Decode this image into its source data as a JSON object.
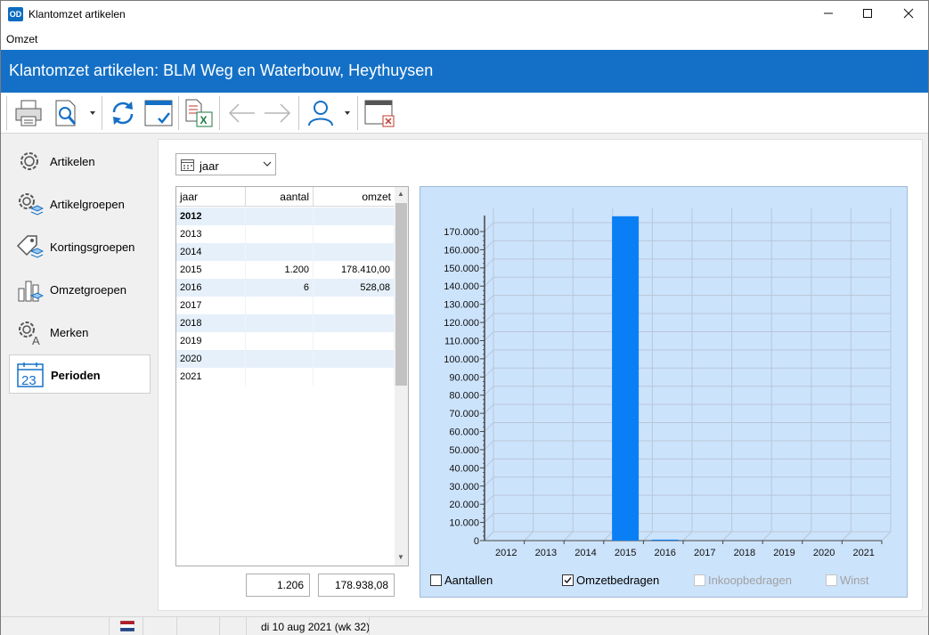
{
  "window": {
    "title": "Klantomzet artikelen",
    "logo": "OD"
  },
  "menu": {
    "items": [
      "Omzet"
    ]
  },
  "banner": {
    "title": "Klantomzet artikelen: BLM Weg en Waterbouw, Heythuysen"
  },
  "toolbar": {
    "icons": [
      "printer-icon",
      "preview-icon",
      "refresh-icon",
      "window-check-icon",
      "export-excel-icon",
      "back-arrow-icon",
      "forward-arrow-icon",
      "person-icon",
      "close-window-icon"
    ]
  },
  "sidebar": {
    "items": [
      {
        "label": "Artikelen",
        "icon": "gear-icon",
        "active": false
      },
      {
        "label": "Artikelgroepen",
        "icon": "gear-stack-icon",
        "active": false
      },
      {
        "label": "Kortingsgroepen",
        "icon": "tag-stack-icon",
        "active": false
      },
      {
        "label": "Omzetgroepen",
        "icon": "bar-chart-icon",
        "active": false
      },
      {
        "label": "Merken",
        "icon": "gear-letter-icon",
        "active": false
      },
      {
        "label": "Perioden",
        "icon": "calendar-icon",
        "active": true,
        "calendar_number": "23"
      }
    ]
  },
  "period_select": {
    "value": "jaar"
  },
  "table": {
    "columns": [
      "jaar",
      "aantal",
      "omzet"
    ],
    "rows": [
      {
        "jaar": "2012",
        "aantal": "",
        "omzet": ""
      },
      {
        "jaar": "2013",
        "aantal": "",
        "omzet": ""
      },
      {
        "jaar": "2014",
        "aantal": "",
        "omzet": ""
      },
      {
        "jaar": "2015",
        "aantal": "1.200",
        "omzet": "178.410,00"
      },
      {
        "jaar": "2016",
        "aantal": "6",
        "omzet": "528,08"
      },
      {
        "jaar": "2017",
        "aantal": "",
        "omzet": ""
      },
      {
        "jaar": "2018",
        "aantal": "",
        "omzet": ""
      },
      {
        "jaar": "2019",
        "aantal": "",
        "omzet": ""
      },
      {
        "jaar": "2020",
        "aantal": "",
        "omzet": ""
      },
      {
        "jaar": "2021",
        "aantal": "",
        "omzet": ""
      }
    ],
    "totals": {
      "aantal": "1.206",
      "omzet": "178.938,08"
    }
  },
  "chart_data": {
    "type": "bar",
    "categories": [
      "2012",
      "2013",
      "2014",
      "2015",
      "2016",
      "2017",
      "2018",
      "2019",
      "2020",
      "2021"
    ],
    "series": [
      {
        "values": [
          0,
          0,
          0,
          178410,
          528.08,
          0,
          0,
          0,
          0,
          0
        ],
        "color": "#0a7ff5"
      }
    ],
    "ylim": [
      0,
      170000
    ],
    "yticks": [
      0,
      10000,
      20000,
      30000,
      40000,
      50000,
      60000,
      70000,
      80000,
      90000,
      100000,
      110000,
      120000,
      130000,
      140000,
      150000,
      160000,
      170000
    ],
    "ytick_labels": [
      "0",
      "10.000",
      "20.000",
      "30.000",
      "40.000",
      "50.000",
      "60.000",
      "70.000",
      "80.000",
      "90.000",
      "100.000",
      "110.000",
      "120.000",
      "130.000",
      "140.000",
      "150.000",
      "160.000",
      "170.000"
    ],
    "grid": true,
    "background": "#cce3fc"
  },
  "chart_options": [
    {
      "label": "Aantallen",
      "checked": false,
      "enabled": true
    },
    {
      "label": "Omzetbedragen",
      "checked": true,
      "enabled": true
    },
    {
      "label": "Inkoopbedragen",
      "checked": false,
      "enabled": false
    },
    {
      "label": "Winst",
      "checked": false,
      "enabled": false
    }
  ],
  "statusbar": {
    "date": "di 10 aug 2021 (wk 32)"
  }
}
